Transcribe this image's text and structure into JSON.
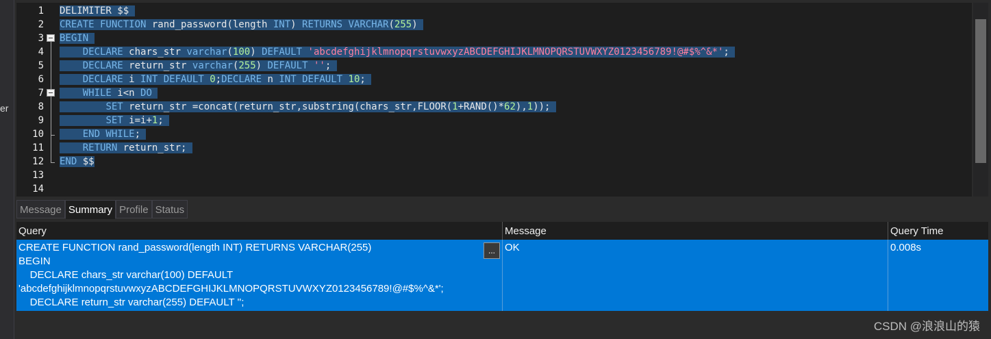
{
  "left_panel": {
    "truncated_label": "er"
  },
  "editor": {
    "line_numbers": [
      "1",
      "2",
      "3",
      "4",
      "5",
      "6",
      "7",
      "8",
      "9",
      "10",
      "11",
      "12",
      "13",
      "14"
    ]
  },
  "tabs": [
    {
      "label": "Message"
    },
    {
      "label": "Summary"
    },
    {
      "label": "Profile"
    },
    {
      "label": "Status"
    }
  ],
  "results": {
    "columns": [
      "Query",
      "Message",
      "Query Time"
    ],
    "row": {
      "query": "CREATE FUNCTION rand_password(length INT) RETURNS VARCHAR(255)\nBEGIN\n    DECLARE chars_str varchar(100) DEFAULT\n'abcdefghijklmnopqrstuvwxyzABCDEFGHIJKLMNOPQRSTUVWXYZ0123456789!@#$%^&*';\n    DECLARE return_str varchar(255) DEFAULT '';",
      "message": "OK",
      "query_time": "0.008s",
      "more_button": "..."
    }
  },
  "watermark": "CSDN @浪浪山的猿",
  "colors": {
    "selection": "#264f78",
    "keyword": "#78b7ea",
    "number": "#b5f29a",
    "string": "#ff7f9f",
    "result_row": "#0078d7"
  }
}
